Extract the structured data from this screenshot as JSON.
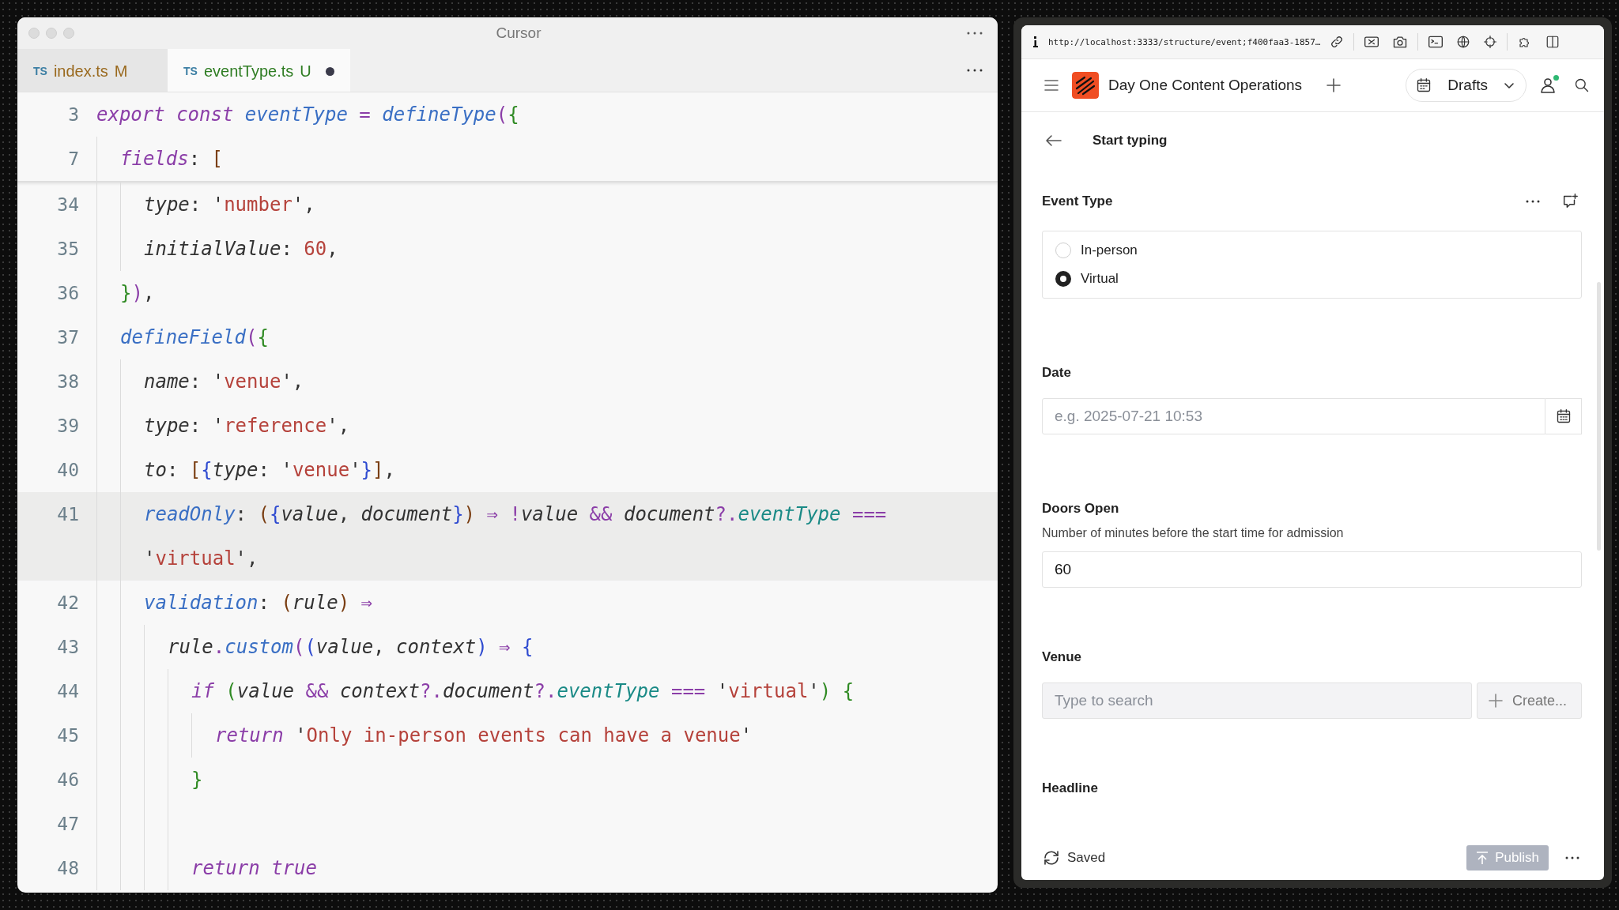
{
  "editor": {
    "title": "Cursor",
    "tabs": [
      {
        "lang": "TS",
        "label": "index.ts",
        "status": "M",
        "color": "#9a6a1f",
        "selected": false,
        "unsaved": false
      },
      {
        "lang": "TS",
        "label": "eventType.ts",
        "status": "U",
        "color": "#2f7d23",
        "selected": true,
        "unsaved": true
      }
    ],
    "sticky_lines": [
      {
        "number": "3",
        "tokens": [
          {
            "text": "export const",
            "kind": "k"
          },
          {
            "text": " eventType ",
            "kind": "f"
          },
          {
            "text": "= ",
            "kind": "o"
          },
          {
            "text": "defineType",
            "kind": "f"
          },
          {
            "text": "(",
            "kind": "x"
          },
          {
            "text": "{",
            "kind": "g"
          }
        ],
        "children": [
          {
            "number": "7",
            "tokens": [
              {
                "text": "fields",
                "kind": "k"
              },
              {
                "text": ": ",
                "kind": "t"
              },
              {
                "text": "[",
                "kind": "r"
              }
            ]
          }
        ]
      }
    ],
    "lines": [
      {
        "children": [
          {
            "number": "34",
            "highlighted": false,
            "tokens": [
              {
                "text": "type",
                "kind": "v"
              },
              {
                "text": ": '",
                "kind": "t"
              },
              {
                "text": "number",
                "kind": "s"
              },
              {
                "text": "',",
                "kind": "t"
              }
            ]
          },
          {
            "number": "35",
            "highlighted": false,
            "tokens": [
              {
                "text": "initialValue",
                "kind": "v"
              },
              {
                "text": ": ",
                "kind": "t"
              },
              {
                "text": "60",
                "kind": "n"
              },
              {
                "text": ",",
                "kind": "t"
              }
            ]
          }
        ]
      },
      {
        "number": "36",
        "highlighted": false,
        "tokens": [
          {
            "text": "}",
            "kind": "g"
          },
          {
            "text": ")",
            "kind": "x"
          },
          {
            "text": ",",
            "kind": "t"
          }
        ]
      },
      {
        "number": "37",
        "highlighted": false,
        "tokens": [
          {
            "text": "defineField",
            "kind": "f"
          },
          {
            "text": "(",
            "kind": "x"
          },
          {
            "text": "{",
            "kind": "g"
          }
        ],
        "children": [
          {
            "number": "38",
            "highlighted": false,
            "tokens": [
              {
                "text": "name",
                "kind": "v"
              },
              {
                "text": ": '",
                "kind": "t"
              },
              {
                "text": "venue",
                "kind": "s"
              },
              {
                "text": "',",
                "kind": "t"
              }
            ]
          },
          {
            "number": "39",
            "highlighted": false,
            "tokens": [
              {
                "text": "type",
                "kind": "v"
              },
              {
                "text": ": '",
                "kind": "t"
              },
              {
                "text": "reference",
                "kind": "s"
              },
              {
                "text": "',",
                "kind": "t"
              }
            ]
          },
          {
            "number": "40",
            "highlighted": false,
            "tokens": [
              {
                "text": "to",
                "kind": "v"
              },
              {
                "text": ": ",
                "kind": "t"
              },
              {
                "text": "[",
                "kind": "r"
              },
              {
                "text": "{",
                "kind": "b"
              },
              {
                "text": "type",
                "kind": "v"
              },
              {
                "text": ": '",
                "kind": "t"
              },
              {
                "text": "venue",
                "kind": "s"
              },
              {
                "text": "'",
                "kind": "t"
              },
              {
                "text": "}",
                "kind": "b"
              },
              {
                "text": "]",
                "kind": "r"
              },
              {
                "text": ",",
                "kind": "t"
              }
            ]
          },
          {
            "number": "41",
            "highlighted": true,
            "tokens": [
              {
                "text": "readOnly",
                "kind": "p"
              },
              {
                "text": ": ",
                "kind": "t"
              },
              {
                "text": "(",
                "kind": "r"
              },
              {
                "text": "{",
                "kind": "b"
              },
              {
                "text": "value",
                "kind": "v"
              },
              {
                "text": ", ",
                "kind": "t"
              },
              {
                "text": "document",
                "kind": "v"
              },
              {
                "text": "}",
                "kind": "b"
              },
              {
                "text": ") ",
                "kind": "r"
              },
              {
                "text": "⇒ !",
                "kind": "o"
              },
              {
                "text": "value ",
                "kind": "v"
              },
              {
                "text": "&& ",
                "kind": "o"
              },
              {
                "text": "document",
                "kind": "v"
              },
              {
                "text": "?.",
                "kind": "o"
              },
              {
                "text": "eventType ",
                "kind": "c"
              },
              {
                "text": "===",
                "kind": "o"
              }
            ],
            "wrapped_tokens": [
              {
                "text": "'",
                "kind": "t"
              },
              {
                "text": "virtual",
                "kind": "s"
              },
              {
                "text": "',",
                "kind": "t"
              }
            ]
          },
          {
            "number": "42",
            "highlighted": false,
            "tokens": [
              {
                "text": "validation",
                "kind": "p"
              },
              {
                "text": ": ",
                "kind": "t"
              },
              {
                "text": "(",
                "kind": "r"
              },
              {
                "text": "rule",
                "kind": "v"
              },
              {
                "text": ") ",
                "kind": "r"
              },
              {
                "text": "⇒",
                "kind": "o"
              }
            ],
            "children": [
              {
                "number": "43",
                "highlighted": false,
                "tokens": [
                  {
                    "text": "rule",
                    "kind": "v"
                  },
                  {
                    "text": ".",
                    "kind": "o"
                  },
                  {
                    "text": "custom",
                    "kind": "f"
                  },
                  {
                    "text": "(",
                    "kind": "x"
                  },
                  {
                    "text": "(",
                    "kind": "b"
                  },
                  {
                    "text": "value",
                    "kind": "v"
                  },
                  {
                    "text": ", ",
                    "kind": "t"
                  },
                  {
                    "text": "context",
                    "kind": "v"
                  },
                  {
                    "text": ") ",
                    "kind": "b"
                  },
                  {
                    "text": "⇒ ",
                    "kind": "o"
                  },
                  {
                    "text": "{",
                    "kind": "b"
                  }
                ],
                "children": [
                  {
                    "number": "44",
                    "highlighted": false,
                    "tokens": [
                      {
                        "text": "if ",
                        "kind": "k"
                      },
                      {
                        "text": "(",
                        "kind": "g"
                      },
                      {
                        "text": "value ",
                        "kind": "v"
                      },
                      {
                        "text": "&& ",
                        "kind": "o"
                      },
                      {
                        "text": "context",
                        "kind": "v"
                      },
                      {
                        "text": "?.",
                        "kind": "o"
                      },
                      {
                        "text": "document",
                        "kind": "v"
                      },
                      {
                        "text": "?.",
                        "kind": "o"
                      },
                      {
                        "text": "eventType ",
                        "kind": "c"
                      },
                      {
                        "text": "=== ",
                        "kind": "o"
                      },
                      {
                        "text": "'",
                        "kind": "t"
                      },
                      {
                        "text": "virtual",
                        "kind": "s"
                      },
                      {
                        "text": "'",
                        "kind": "t"
                      },
                      {
                        "text": ") ",
                        "kind": "g"
                      },
                      {
                        "text": "{",
                        "kind": "g"
                      }
                    ],
                    "children": [
                      {
                        "number": "45",
                        "highlighted": false,
                        "tokens": [
                          {
                            "text": "return ",
                            "kind": "k"
                          },
                          {
                            "text": "'",
                            "kind": "t"
                          },
                          {
                            "text": "Only in-person events can have a venue",
                            "kind": "s"
                          },
                          {
                            "text": "'",
                            "kind": "t"
                          }
                        ]
                      }
                    ]
                  },
                  {
                    "number": "46",
                    "highlighted": false,
                    "tokens": [
                      {
                        "text": "}",
                        "kind": "g"
                      }
                    ]
                  },
                  {
                    "number": "47",
                    "highlighted": false
                  },
                  {
                    "number": "48",
                    "highlighted": false,
                    "tokens": [
                      {
                        "text": "return true",
                        "kind": "k"
                      }
                    ]
                  }
                ]
              }
            ]
          }
        ]
      }
    ]
  },
  "browser": {
    "url": "http://localhost:3333/structure/event;f400faa3-1857…",
    "app": {
      "title": "Day One Content Operations",
      "perspective": "Drafts",
      "user_online": true
    },
    "document": {
      "title": "Start typing",
      "event_type": {
        "label": "Event Type",
        "options": [
          {
            "label": "In-person",
            "selected": false
          },
          {
            "label": "Virtual",
            "selected": true
          }
        ]
      },
      "date": {
        "label": "Date",
        "placeholder": "e.g. 2025-07-21 10:53"
      },
      "doors_open": {
        "label": "Doors Open",
        "description": "Number of minutes before the start time for admission",
        "value": "60"
      },
      "venue": {
        "label": "Venue",
        "placeholder": "Type to search",
        "create": "Create..."
      },
      "headline": {
        "label": "Headline"
      }
    },
    "footer": {
      "status": "Saved",
      "publish": {
        "label": "Publish",
        "disabled": true
      }
    }
  }
}
